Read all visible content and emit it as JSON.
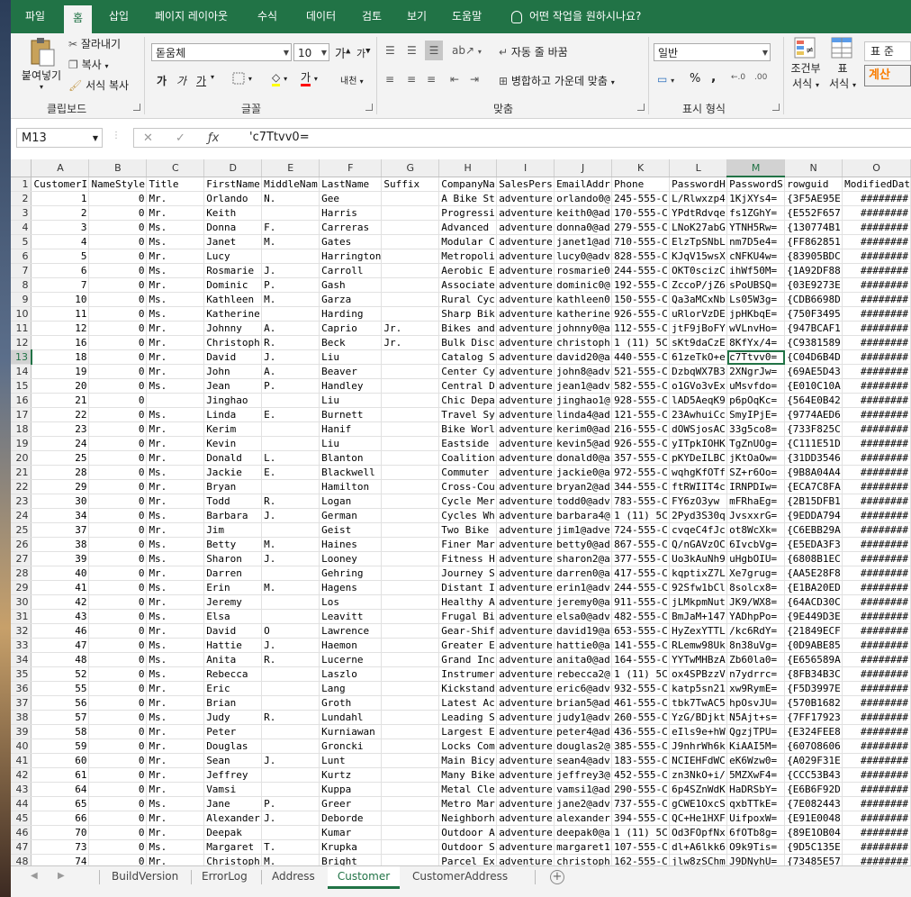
{
  "tabs": [
    "파일",
    "홈",
    "삽입",
    "페이지 레이아웃",
    "수식",
    "데이터",
    "검토",
    "보기",
    "도움말"
  ],
  "tell_me": "어떤 작업을 원하시나요?",
  "clipboard": {
    "paste": "붙여넣기",
    "cut": "잘라내기",
    "copy": "복사",
    "format_painter": "서식 복사",
    "label": "클립보드"
  },
  "font": {
    "name": "돋움체",
    "size": "10",
    "grow": "가",
    "shrink": "가",
    "bold": "가",
    "italic": "가",
    "underline": "가",
    "label": "글꼴",
    "phonetic": "내천"
  },
  "alignment": {
    "wrap": "자동 줄 바꿈",
    "merge": "병합하고 가운데 맞춤",
    "label": "맞춤"
  },
  "number": {
    "format": "일반",
    "percent": "%",
    "comma": ",",
    "label": "표시 형식"
  },
  "styles": {
    "conditional": "조건부",
    "conditional2": "서식",
    "table": "표",
    "table2": "서식",
    "normal": "표 준",
    "calc": "계산"
  },
  "formula_bar": {
    "name_box": "M13",
    "value": "'c7Ttvv0="
  },
  "columns": [
    "A",
    "B",
    "C",
    "D",
    "E",
    "F",
    "G",
    "H",
    "I",
    "J",
    "K",
    "L",
    "M",
    "N",
    "O"
  ],
  "selected_col": "M",
  "selected_row": 13,
  "rows": [
    {
      "n": 1,
      "c": [
        "CustomerI",
        "NameStyle",
        "Title",
        "FirstName",
        "MiddleNam",
        "LastName",
        "Suffix",
        "CompanyNa",
        "SalesPers",
        "EmailAddr",
        "Phone",
        "PasswordH",
        "PasswordS",
        "rowguid",
        "ModifiedDat"
      ]
    },
    {
      "n": 2,
      "c": [
        "1",
        "0",
        "Mr.",
        "Orlando",
        "N.",
        "Gee",
        "",
        "A Bike St",
        "adventure",
        "orlando0@",
        "245-555-C",
        "L/Rlwxzp4",
        "1KjXYs4=",
        "{3F5AE95E",
        "########"
      ]
    },
    {
      "n": 3,
      "c": [
        "2",
        "0",
        "Mr.",
        "Keith",
        "",
        "Harris",
        "",
        "Progressi",
        "adventure",
        "keith0@ad",
        "170-555-C",
        "YPdtRdvqe",
        "fs1ZGhY=",
        "{E552F657",
        "########"
      ]
    },
    {
      "n": 4,
      "c": [
        "3",
        "0",
        "Ms.",
        "Donna",
        "F.",
        "Carreras",
        "",
        "Advanced",
        "adventure",
        "donna0@ad",
        "279-555-C",
        "LNoK27abG",
        "YTNH5Rw=",
        "{130774B1",
        "########"
      ]
    },
    {
      "n": 5,
      "c": [
        "4",
        "0",
        "Ms.",
        "Janet",
        "M.",
        "Gates",
        "",
        "Modular C",
        "adventure",
        "janet1@ad",
        "710-555-C",
        "ElzTpSNbL",
        "nm7D5e4=",
        "{FF862851",
        "########"
      ]
    },
    {
      "n": 6,
      "c": [
        "5",
        "0",
        "Mr.",
        "Lucy",
        "",
        "Harrington",
        "",
        "Metropoli",
        "adventure",
        "lucy0@adv",
        "828-555-C",
        "KJqV15wsX",
        "cNFKU4w=",
        "{83905BDC",
        "########"
      ]
    },
    {
      "n": 7,
      "c": [
        "6",
        "0",
        "Ms.",
        "Rosmarie",
        "J.",
        "Carroll",
        "",
        "Aerobic E",
        "adventure",
        "rosmarie0",
        "244-555-C",
        "OKT0scizC",
        "ihWf50M=",
        "{1A92DF88",
        "########"
      ]
    },
    {
      "n": 8,
      "c": [
        "7",
        "0",
        "Mr.",
        "Dominic",
        "P.",
        "Gash",
        "",
        "Associate",
        "adventure",
        "dominic0@",
        "192-555-C",
        "ZccoP/jZ6",
        "sPoUBSQ=",
        "{03E9273E",
        "########"
      ]
    },
    {
      "n": 9,
      "c": [
        "10",
        "0",
        "Ms.",
        "Kathleen",
        "M.",
        "Garza",
        "",
        "Rural Cyc",
        "adventure",
        "kathleen0",
        "150-555-C",
        "Qa3aMCxNb",
        "Ls05W3g=",
        "{CDB6698D",
        "########"
      ]
    },
    {
      "n": 10,
      "c": [
        "11",
        "0",
        "Ms.",
        "Katherine",
        "",
        "Harding",
        "",
        "Sharp Bik",
        "adventure",
        "katherine",
        "926-555-C",
        "uRlorVzDE",
        "jpHKbqE=",
        "{750F3495",
        "########"
      ]
    },
    {
      "n": 11,
      "c": [
        "12",
        "0",
        "Mr.",
        "Johnny",
        "A.",
        "Caprio",
        "Jr.",
        "Bikes and",
        "adventure",
        "johnny0@a",
        "112-555-C",
        "jtF9jBoFY",
        "wVLnvHo=",
        "{947BCAF1",
        "########"
      ]
    },
    {
      "n": 12,
      "c": [
        "16",
        "0",
        "Mr.",
        "Christoph",
        "R.",
        "Beck",
        "Jr.",
        "Bulk Disc",
        "adventure",
        "christoph",
        "1 (11) 5C",
        "sKt9daCzE",
        "8KfYx/4=",
        "{C9381589",
        "########"
      ]
    },
    {
      "n": 13,
      "c": [
        "18",
        "0",
        "Mr.",
        "David",
        "J.",
        "Liu",
        "",
        "Catalog S",
        "adventure",
        "david20@a",
        "440-555-C",
        "61zeTkO+e",
        "c7Ttvv0=",
        "{C04D6B4D",
        "########"
      ]
    },
    {
      "n": 14,
      "c": [
        "19",
        "0",
        "Mr.",
        "John",
        "A.",
        "Beaver",
        "",
        "Center Cy",
        "adventure",
        "john8@adv",
        "521-555-C",
        "DzbqWX7B3",
        "2XNgrJw=",
        "{69AE5D43",
        "########"
      ]
    },
    {
      "n": 15,
      "c": [
        "20",
        "0",
        "Ms.",
        "Jean",
        "P.",
        "Handley",
        "",
        "Central D",
        "adventure",
        "jean1@adv",
        "582-555-C",
        "o1GVo3vEx",
        "uMsvfdo=",
        "{E010C10A",
        "########"
      ]
    },
    {
      "n": 16,
      "c": [
        "21",
        "0",
        "",
        "Jinghao",
        "",
        "Liu",
        "",
        "Chic Depa",
        "adventure",
        "jinghao1@",
        "928-555-C",
        "lAD5AeqK9",
        "p6pOqKc=",
        "{564E0B42",
        "########"
      ]
    },
    {
      "n": 17,
      "c": [
        "22",
        "0",
        "Ms.",
        "Linda",
        "E.",
        "Burnett",
        "",
        "Travel Sy",
        "adventure",
        "linda4@ad",
        "121-555-C",
        "23AwhuiCc",
        "SmyIPjE=",
        "{9774AED6",
        "########"
      ]
    },
    {
      "n": 18,
      "c": [
        "23",
        "0",
        "Mr.",
        "Kerim",
        "",
        "Hanif",
        "",
        "Bike Worl",
        "adventure",
        "kerim0@ad",
        "216-555-C",
        "dOWSjosAC",
        "33g5co8=",
        "{733F825C",
        "########"
      ]
    },
    {
      "n": 19,
      "c": [
        "24",
        "0",
        "Mr.",
        "Kevin",
        "",
        "Liu",
        "",
        "Eastside",
        "adventure",
        "kevin5@ad",
        "926-555-C",
        "yITpkIOHK",
        "TgZnUOg=",
        "{C111E51D",
        "########"
      ]
    },
    {
      "n": 20,
      "c": [
        "25",
        "0",
        "Mr.",
        "Donald",
        "L.",
        "Blanton",
        "",
        "Coalition",
        "adventure",
        "donald0@a",
        "357-555-C",
        "pKYDeILBC",
        "jKtOaOw=",
        "{31DD3546",
        "########"
      ]
    },
    {
      "n": 21,
      "c": [
        "28",
        "0",
        "Ms.",
        "Jackie",
        "E.",
        "Blackwell",
        "",
        "Commuter",
        "adventure",
        "jackie0@a",
        "972-555-C",
        "wqhgKfOTf",
        "SZ+r6Oo=",
        "{9B8A04A4",
        "########"
      ]
    },
    {
      "n": 22,
      "c": [
        "29",
        "0",
        "Mr.",
        "Bryan",
        "",
        "Hamilton",
        "",
        "Cross-Cou",
        "adventure",
        "bryan2@ad",
        "344-555-C",
        "ftRWIIT4c",
        "IRNPDIw=",
        "{ECA7C8FA",
        "########"
      ]
    },
    {
      "n": 23,
      "c": [
        "30",
        "0",
        "Mr.",
        "Todd",
        "R.",
        "Logan",
        "",
        "Cycle Mer",
        "adventure",
        "todd0@adv",
        "783-555-C",
        "FY6zO3yw",
        "mFRhaEg=",
        "{2B15DFB1",
        "########"
      ]
    },
    {
      "n": 24,
      "c": [
        "34",
        "0",
        "Ms.",
        "Barbara",
        "J.",
        "German",
        "",
        "Cycles Wh",
        "adventure",
        "barbara4@",
        "1 (11) 5C",
        "2Pyd3S30q",
        "JvsxxrG=",
        "{9EDDA794",
        "########"
      ]
    },
    {
      "n": 25,
      "c": [
        "37",
        "0",
        "Mr.",
        "Jim",
        "",
        "Geist",
        "",
        "Two Bike",
        "adventure",
        "jim1@adve",
        "724-555-C",
        "cvqeC4fJc",
        "ot8WcXk=",
        "{C6EBB29A",
        "########"
      ]
    },
    {
      "n": 26,
      "c": [
        "38",
        "0",
        "Ms.",
        "Betty",
        "M.",
        "Haines",
        "",
        "Finer Mar",
        "adventure",
        "betty0@ad",
        "867-555-C",
        "Q/nGAVzOC",
        "6IvcbVg=",
        "{E5EDA3F3",
        "########"
      ]
    },
    {
      "n": 27,
      "c": [
        "39",
        "0",
        "Ms.",
        "Sharon",
        "J.",
        "Looney",
        "",
        "Fitness H",
        "adventure",
        "sharon2@a",
        "377-555-C",
        "Uo3kAuNh9",
        "uHgbOIU=",
        "{6808B1EC",
        "########"
      ]
    },
    {
      "n": 28,
      "c": [
        "40",
        "0",
        "Mr.",
        "Darren",
        "",
        "Gehring",
        "",
        "Journey S",
        "adventure",
        "darren0@a",
        "417-555-C",
        "kqptixZ7L",
        "Xe7grug=",
        "{AA5E28F8",
        "########"
      ]
    },
    {
      "n": 29,
      "c": [
        "41",
        "0",
        "Ms.",
        "Erin",
        "M.",
        "Hagens",
        "",
        "Distant I",
        "adventure",
        "erin1@adv",
        "244-555-C",
        "92Sfw1bCl",
        "8solcx8=",
        "{E1BA20ED",
        "########"
      ]
    },
    {
      "n": 30,
      "c": [
        "42",
        "0",
        "Mr.",
        "Jeremy",
        "",
        "Los",
        "",
        "Healthy A",
        "adventure",
        "jeremy0@a",
        "911-555-C",
        "jLMkpmNut",
        "JK9/WX8=",
        "{64ACD30C",
        "########"
      ]
    },
    {
      "n": 31,
      "c": [
        "43",
        "0",
        "Ms.",
        "Elsa",
        "",
        "Leavitt",
        "",
        "Frugal Bi",
        "adventure",
        "elsa0@adv",
        "482-555-C",
        "BmJaM+147",
        "YADhpPo=",
        "{9E449D3E",
        "########"
      ]
    },
    {
      "n": 32,
      "c": [
        "46",
        "0",
        "Mr.",
        "David",
        "O",
        "Lawrence",
        "",
        "Gear-Shif",
        "adventure",
        "david19@a",
        "653-555-C",
        "HyZexYTTL",
        "/kc6RdY=",
        "{21849ECF",
        "########"
      ]
    },
    {
      "n": 33,
      "c": [
        "47",
        "0",
        "Ms.",
        "Hattie",
        "J.",
        "Haemon",
        "",
        "Greater E",
        "adventure",
        "hattie0@a",
        "141-555-C",
        "RLemw98Uk",
        "8n38uVg=",
        "{0D9ABE85",
        "########"
      ]
    },
    {
      "n": 34,
      "c": [
        "48",
        "0",
        "Ms.",
        "Anita",
        "R.",
        "Lucerne",
        "",
        "Grand Inc",
        "adventure",
        "anita0@ad",
        "164-555-C",
        "YYTwMHBzA",
        "Zb60la0=",
        "{E656589A",
        "########"
      ]
    },
    {
      "n": 35,
      "c": [
        "52",
        "0",
        "Ms.",
        "Rebecca",
        "",
        "Laszlo",
        "",
        "Instrumer",
        "adventure",
        "rebecca2@",
        "1 (11) 5C",
        "ox4SPBzzV",
        "n7ydrrc=",
        "{8FB34B3C",
        "########"
      ]
    },
    {
      "n": 36,
      "c": [
        "55",
        "0",
        "Mr.",
        "Eric",
        "",
        "Lang",
        "",
        "Kickstand",
        "adventure",
        "eric6@adv",
        "932-555-C",
        "katp5sn21",
        "xw9RymE=",
        "{F5D3997E",
        "########"
      ]
    },
    {
      "n": 37,
      "c": [
        "56",
        "0",
        "Mr.",
        "Brian",
        "",
        "Groth",
        "",
        "Latest Ac",
        "adventure",
        "brian5@ad",
        "461-555-C",
        "tbk7TwAC5",
        "hpOsvJU=",
        "{570B1682",
        "########"
      ]
    },
    {
      "n": 38,
      "c": [
        "57",
        "0",
        "Ms.",
        "Judy",
        "R.",
        "Lundahl",
        "",
        "Leading S",
        "adventure",
        "judy1@adv",
        "260-555-C",
        "YzG/BDjkt",
        "N5Ajt+s=",
        "{7FF17923",
        "########"
      ]
    },
    {
      "n": 39,
      "c": [
        "58",
        "0",
        "Mr.",
        "Peter",
        "",
        "Kurniawan",
        "",
        "Largest E",
        "adventure",
        "peter4@ad",
        "436-555-C",
        "eIls9e+hW",
        "QgzjTPU=",
        "{E324FEE8",
        "########"
      ]
    },
    {
      "n": 40,
      "c": [
        "59",
        "0",
        "Mr.",
        "Douglas",
        "",
        "Groncki",
        "",
        "Locks Com",
        "adventure",
        "douglas2@",
        "385-555-C",
        "J9nhrWh6k",
        "KiAAI5M=",
        "{607O8606",
        "########"
      ]
    },
    {
      "n": 41,
      "c": [
        "60",
        "0",
        "Mr.",
        "Sean",
        "J.",
        "Lunt",
        "",
        "Main Bicy",
        "adventure",
        "sean4@adv",
        "183-555-C",
        "NCIEHFdWC",
        "eK6Wzw0=",
        "{A029F31E",
        "########"
      ]
    },
    {
      "n": 42,
      "c": [
        "61",
        "0",
        "Mr.",
        "Jeffrey",
        "",
        "Kurtz",
        "",
        "Many Bike",
        "adventure",
        "jeffrey3@",
        "452-555-C",
        "zn3NkO+i/",
        "5MZXwF4=",
        "{CCC53B43",
        "########"
      ]
    },
    {
      "n": 43,
      "c": [
        "64",
        "0",
        "Mr.",
        "Vamsi",
        "",
        "Kuppa",
        "",
        "Metal Cle",
        "adventure",
        "vamsi1@ad",
        "290-555-C",
        "6p4SZnWdK",
        "HaDRSbY=",
        "{E6B6F92D",
        "########"
      ]
    },
    {
      "n": 44,
      "c": [
        "65",
        "0",
        "Ms.",
        "Jane",
        "P.",
        "Greer",
        "",
        "Metro Mar",
        "adventure",
        "jane2@adv",
        "737-555-C",
        "gCWE1OxcS",
        "qxbTTkE=",
        "{7E082443",
        "########"
      ]
    },
    {
      "n": 45,
      "c": [
        "66",
        "0",
        "Mr.",
        "Alexander",
        "J.",
        "Deborde",
        "",
        "Neighborh",
        "adventure",
        "alexander",
        "394-555-C",
        "QC+He1HXF",
        "UifpoxW=",
        "{E91E0048",
        "########"
      ]
    },
    {
      "n": 46,
      "c": [
        "70",
        "0",
        "Mr.",
        "Deepak",
        "",
        "Kumar",
        "",
        "Outdoor A",
        "adventure",
        "deepak0@a",
        "1 (11) 5C",
        "Od3FOpfNx",
        "6fOTb8g=",
        "{89E1OB04",
        "########"
      ]
    },
    {
      "n": 47,
      "c": [
        "73",
        "0",
        "Ms.",
        "Margaret",
        "T.",
        "Krupka",
        "",
        "Outdoor S",
        "adventure",
        "margaret1",
        "107-555-C",
        "dl+A6lkk6",
        "O9k9Tis=",
        "{9D5C135E",
        "########"
      ]
    },
    {
      "n": 48,
      "c": [
        "74",
        "0",
        "Mr.",
        "Christoph",
        "M.",
        "Bright",
        "",
        "Parcel Ex",
        "adventure",
        "christoph",
        "162-555-C",
        "jlw8zSChm",
        "J9DNyhU=",
        "{73485E57",
        "########"
      ]
    }
  ],
  "sheets": [
    "BuildVersion",
    "ErrorLog",
    "Address",
    "Customer",
    "CustomerAddress"
  ],
  "active_sheet": "Customer"
}
